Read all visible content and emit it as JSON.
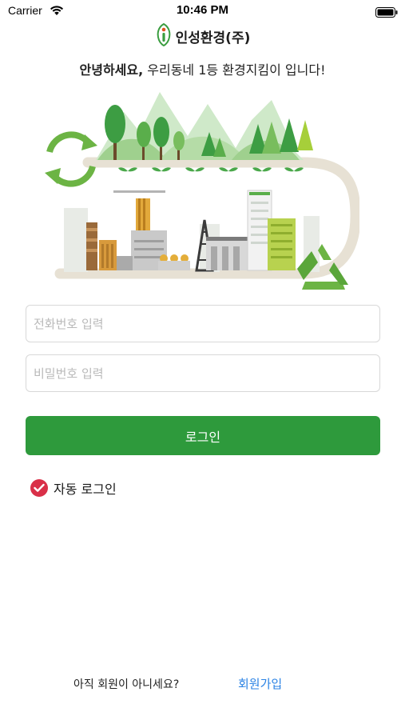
{
  "status_bar": {
    "carrier": "Carrier",
    "time": "10:46 PM",
    "icons": [
      "wifi-icon",
      "battery-icon"
    ]
  },
  "brand": {
    "name": "인성환경(주)",
    "logo_icon": "leaf-i-logo-icon",
    "accent_color": "#3a9d3f"
  },
  "greeting": {
    "bold_part": "안녕하세요,",
    "rest": " 우리동네 1등 환경지킴이 입니다!"
  },
  "hero": {
    "illustration": "eco-city-illustration",
    "icons": [
      "recycle-arrows-icon",
      "recycle-triangle-icon"
    ]
  },
  "form": {
    "phone_placeholder": "전화번호 입력",
    "phone_value": "",
    "password_placeholder": "비밀번호 입력",
    "password_value": "",
    "login_label": "로그인",
    "login_color": "#2e9a3c",
    "auto_login_label": "자동 로그인",
    "auto_login_checked": true,
    "auto_login_color": "#d93048"
  },
  "footer": {
    "question": "아직 회원이 아니세요?",
    "signup_label": "회원가입",
    "signup_color": "#2a82e4"
  }
}
